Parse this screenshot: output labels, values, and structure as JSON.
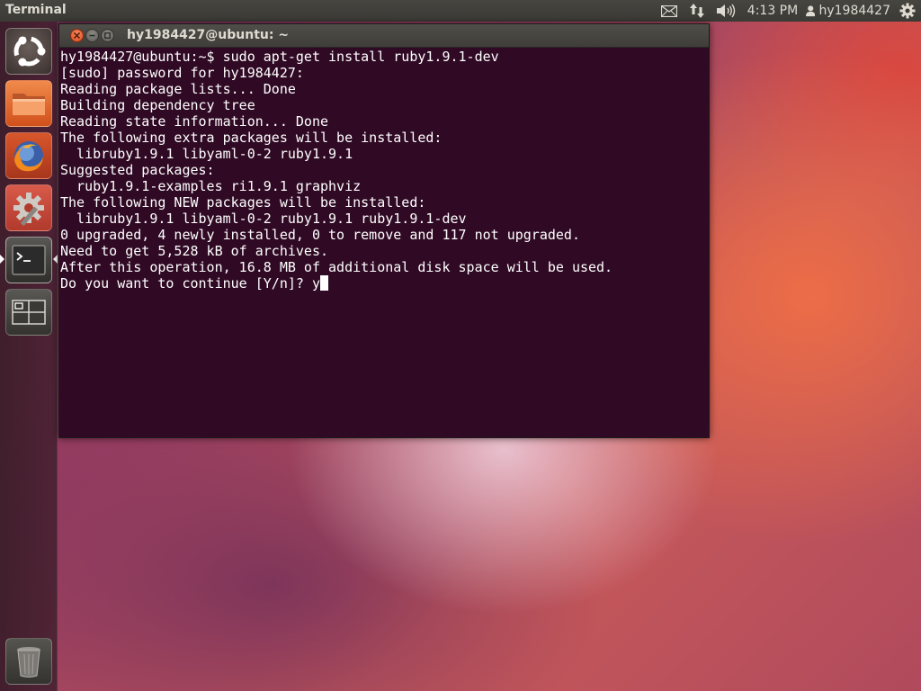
{
  "top_panel": {
    "app_title": "Terminal",
    "clock": "4:13 PM",
    "username": "hy1984427"
  },
  "launcher": {
    "items": [
      {
        "name": "dash-home",
        "icon": "ubuntu-logo-icon"
      },
      {
        "name": "files",
        "icon": "folder-icon"
      },
      {
        "name": "firefox",
        "icon": "firefox-icon"
      },
      {
        "name": "system-settings",
        "icon": "settings-icon"
      },
      {
        "name": "terminal",
        "icon": "terminal-icon",
        "active": true
      },
      {
        "name": "workspace-switcher",
        "icon": "workspace-switcher-icon"
      },
      {
        "name": "trash",
        "icon": "trash-icon"
      }
    ]
  },
  "window": {
    "title": "hy1984427@ubuntu: ~"
  },
  "terminal": {
    "lines": [
      "hy1984427@ubuntu:~$ sudo apt-get install ruby1.9.1-dev",
      "[sudo] password for hy1984427:",
      "Reading package lists... Done",
      "Building dependency tree",
      "Reading state information... Done",
      "The following extra packages will be installed:",
      "  libruby1.9.1 libyaml-0-2 ruby1.9.1",
      "Suggested packages:",
      "  ruby1.9.1-examples ri1.9.1 graphviz",
      "The following NEW packages will be installed:",
      "  libruby1.9.1 libyaml-0-2 ruby1.9.1 ruby1.9.1-dev",
      "0 upgraded, 4 newly installed, 0 to remove and 117 not upgraded.",
      "Need to get 5,528 kB of archives.",
      "After this operation, 16.8 MB of additional disk space will be used.",
      "Do you want to continue [Y/n]? y"
    ]
  },
  "colors": {
    "terminal_bg": "#300a24",
    "panel_bg": "#3c3b37",
    "close_button": "#e2561f"
  }
}
